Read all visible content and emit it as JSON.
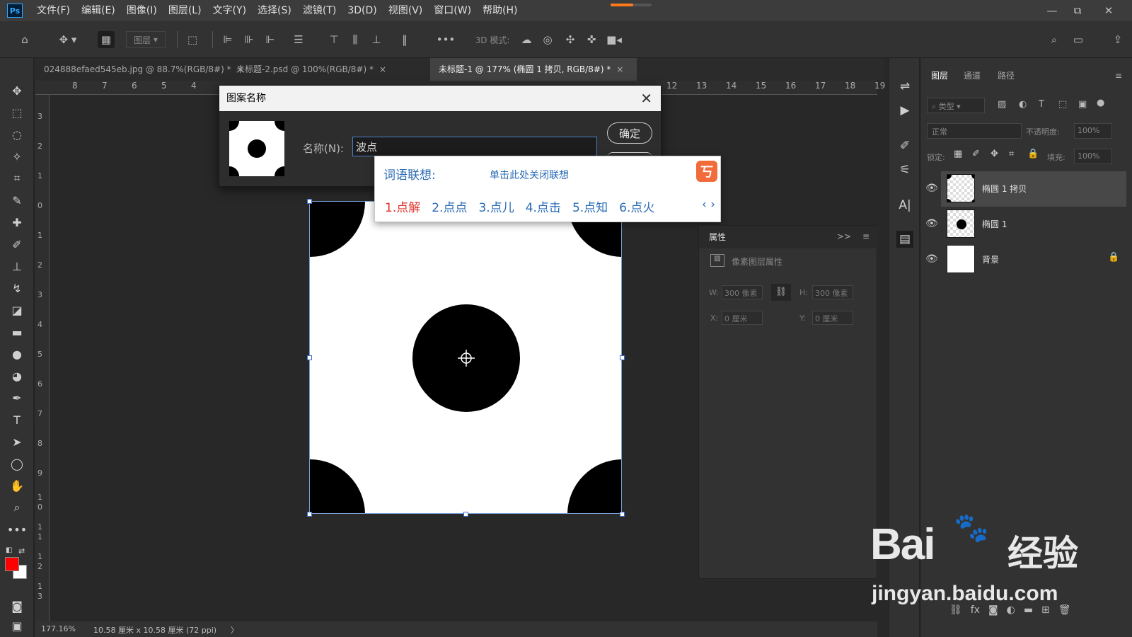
{
  "app": {
    "logo": "Ps"
  },
  "menu": [
    "文件(F)",
    "编辑(E)",
    "图像(I)",
    "图层(L)",
    "文字(Y)",
    "选择(S)",
    "滤镜(T)",
    "3D(D)",
    "视图(V)",
    "窗口(W)",
    "帮助(H)"
  ],
  "progress": 0.55,
  "window_controls": [
    "—",
    "⧉",
    "✕"
  ],
  "options": {
    "layer_select": "图层",
    "mode3d": "3D 模式:"
  },
  "tabs": [
    {
      "label": "024888efaed545eb.jpg @ 88.7%(RGB/8#) *",
      "close": "×"
    },
    {
      "label": "未标题-2.psd @ 100%(RGB/8#) *",
      "close": "×"
    },
    {
      "label": "未标题-1 @ 177% (椭圆 1 拷贝, RGB/8#) *",
      "close": "×"
    }
  ],
  "ruler_top": [
    "8",
    "7",
    "6",
    "5",
    "4",
    "12",
    "13",
    "14",
    "15",
    "16",
    "17",
    "18",
    "19"
  ],
  "ruler_left": [
    "3",
    "2",
    "1",
    "0",
    "1",
    "2",
    "3",
    "4",
    "5",
    "6",
    "7",
    "8",
    "9",
    "1",
    "0",
    "1",
    "1",
    "1",
    "2",
    "1",
    "3"
  ],
  "status": {
    "zoom": "177.16%",
    "doc": "10.58 厘米 x 10.58 厘米 (72 ppi)",
    "arrow": "〉"
  },
  "dialog": {
    "title": "图案名称",
    "close": "✕",
    "name_label": "名称(N):",
    "name_value": "波点",
    "ok": "确定"
  },
  "ime": {
    "title": "词语联想:",
    "close_hint": "单击此处关闭联想",
    "logo": "丂",
    "candidates": [
      "1.点解",
      "2.点点",
      "3.点儿",
      "4.点击",
      "5.点知",
      "6.点火"
    ],
    "prev": "‹",
    "next": "›"
  },
  "properties": {
    "tab": "属性",
    "title": "像素图层属性",
    "w_label": "W:",
    "w": "300 像素",
    "h_label": "H:",
    "h": "300 像素",
    "x_label": "X:",
    "x": "0 厘米",
    "y_label": "Y:",
    "y": "0 厘米"
  },
  "layers": {
    "tabs": [
      "图层",
      "通道",
      "路径"
    ],
    "filter": "类型",
    "blend": "正常",
    "opacity_label": "不透明度:",
    "opacity": "100%",
    "lock_label": "锁定:",
    "fill_label": "填充:",
    "fill": "100%",
    "items": [
      {
        "name": "椭圆 1 拷贝"
      },
      {
        "name": "椭圆 1"
      },
      {
        "name": "背景"
      }
    ]
  },
  "watermark": {
    "brand": "Bai",
    "brand2": "经验",
    "url": "jingyan.baidu.com"
  },
  "colors": {
    "fg": "#ff0000",
    "bg": "#ffffff",
    "accent": "#31a8ff"
  }
}
